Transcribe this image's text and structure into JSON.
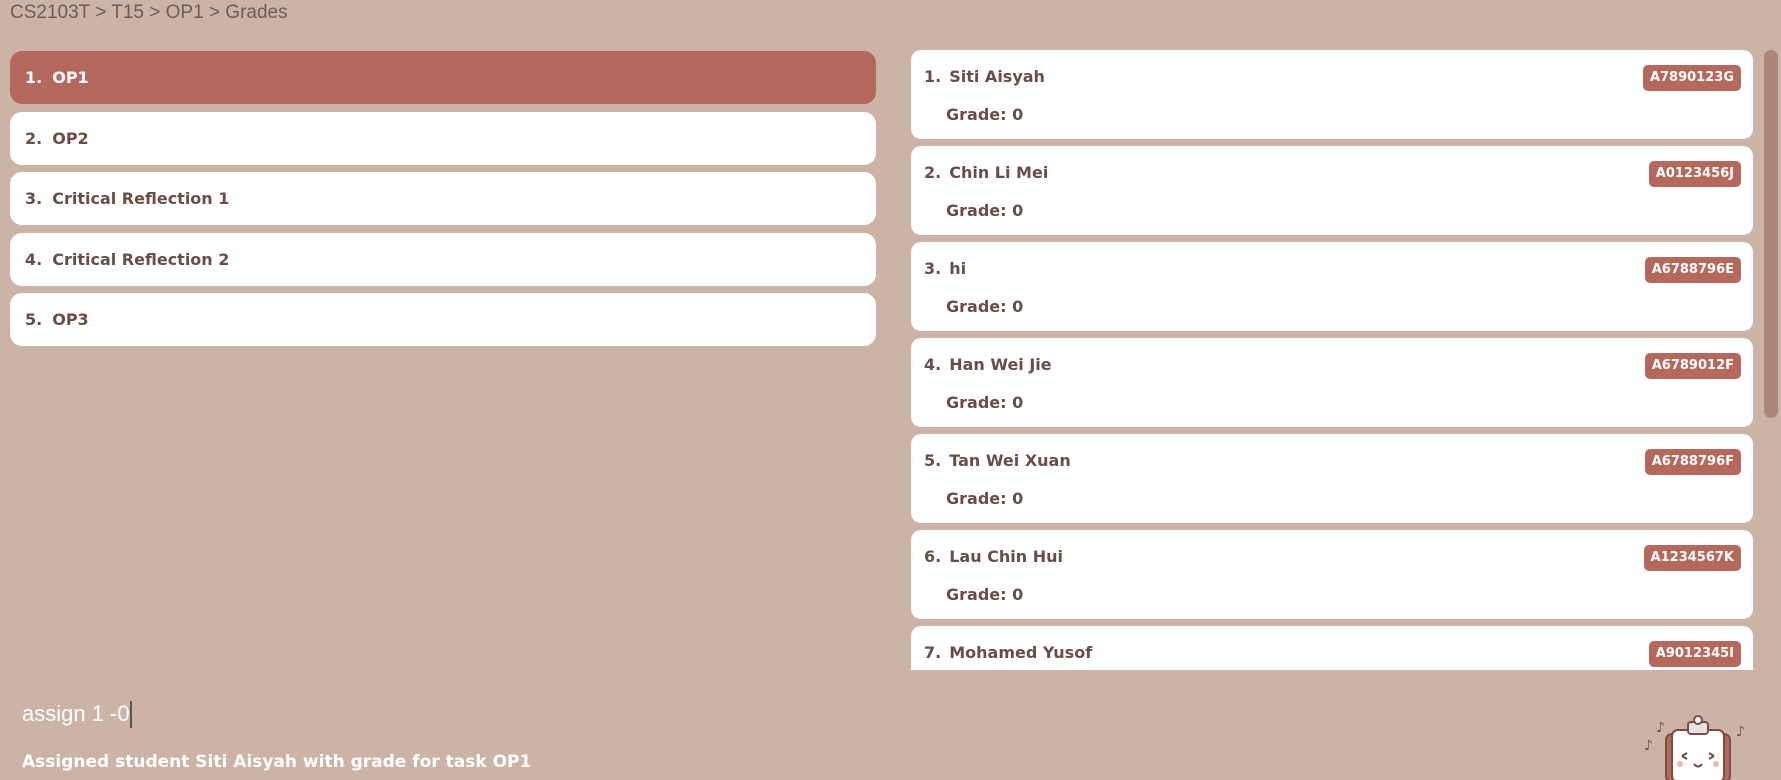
{
  "breadcrumb": "CS2103T > T15 > OP1 > Grades",
  "tasks": [
    {
      "index": "1.",
      "name": "OP1",
      "selected": true
    },
    {
      "index": "2.",
      "name": "OP2",
      "selected": false
    },
    {
      "index": "3.",
      "name": "Critical Reflection 1",
      "selected": false
    },
    {
      "index": "4.",
      "name": "Critical Reflection 2",
      "selected": false
    },
    {
      "index": "5.",
      "name": "OP3",
      "selected": false
    }
  ],
  "students": [
    {
      "index": "1.",
      "name": "Siti Aisyah",
      "id": "A7890123G",
      "grade": "Grade: 0"
    },
    {
      "index": "2.",
      "name": "Chin Li Mei",
      "id": "A0123456J",
      "grade": "Grade: 0"
    },
    {
      "index": "3.",
      "name": "hi",
      "id": "A6788796E",
      "grade": "Grade: 0"
    },
    {
      "index": "4.",
      "name": "Han Wei Jie",
      "id": "A6789012F",
      "grade": "Grade: 0"
    },
    {
      "index": "5.",
      "name": "Tan Wei Xuan",
      "id": "A6788796F",
      "grade": "Grade: 0"
    },
    {
      "index": "6.",
      "name": "Lau Chin Hui",
      "id": "A1234567K",
      "grade": "Grade: 0"
    },
    {
      "index": "7.",
      "name": "Mohamed Yusof",
      "id": "A9012345I",
      "grade": ""
    }
  ],
  "command": {
    "value": "assign 1 -0"
  },
  "result": "Assigned student Siti Aisyah with grade for task OP1",
  "mascot": {
    "icon": "clipboard-mascot-icon"
  },
  "colors": {
    "background": "#cbb3a6",
    "accent": "#b5695c",
    "card": "#ffffff",
    "text": "#6b4d45"
  }
}
